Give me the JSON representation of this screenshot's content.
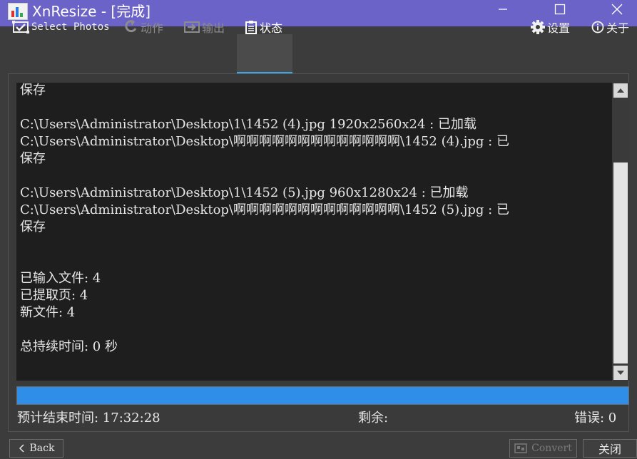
{
  "window": {
    "title": "XnResize - [完成]",
    "icons": {
      "app": "app-icon",
      "minimize": "minimize-icon",
      "maximize": "maximize-icon",
      "close": "close-icon"
    }
  },
  "toolbar": {
    "select_photos": "Select Photos",
    "action": "动作",
    "output": "输出",
    "status": "状态",
    "settings": "设置",
    "about": "关于",
    "active_tab": "状态"
  },
  "log": {
    "lines": [
      "保存",
      "",
      "C:\\Users\\Administrator\\Desktop\\1\\1452 (4).jpg 1920x2560x24 : 已加载",
      "C:\\Users\\Administrator\\Desktop\\啊啊啊啊啊啊啊啊啊啊啊啊啊\\1452 (4).jpg : 已",
      "保存",
      "",
      "C:\\Users\\Administrator\\Desktop\\1\\1452 (5).jpg 960x1280x24 : 已加载",
      "C:\\Users\\Administrator\\Desktop\\啊啊啊啊啊啊啊啊啊啊啊啊啊\\1452 (5).jpg : 已",
      "保存",
      "",
      "",
      "已输入文件: 4",
      "已提取页: 4",
      "新文件: 4",
      "",
      "总持续时间: 0 秒"
    ]
  },
  "progress": {
    "value_percent": 100
  },
  "status": {
    "eta": "预计结束时间: 17:32:28",
    "remaining": "剩余:",
    "errors": "错误: 0"
  },
  "buttons": {
    "back": "Back",
    "convert": "Convert",
    "close": "关闭"
  },
  "colors": {
    "titlebar": "#6b63c8",
    "progress": "#2f8ee8",
    "active_tab_underline": "#3da5e8"
  }
}
